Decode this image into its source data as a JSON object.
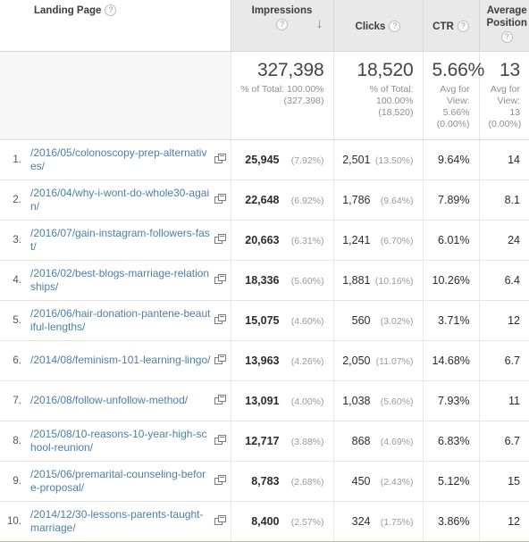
{
  "table": {
    "columns": [
      {
        "key": "index",
        "label": "",
        "help": false,
        "sorted": null
      },
      {
        "key": "page",
        "label": "Landing Page",
        "help": true,
        "sorted": null
      },
      {
        "key": "impressions",
        "label": "Impressions",
        "help": true,
        "sorted": "desc",
        "sort_glyph": "↓"
      },
      {
        "key": "clicks",
        "label": "Clicks",
        "help": true,
        "sorted": null
      },
      {
        "key": "ctr",
        "label": "CTR",
        "help": true,
        "sorted": null
      },
      {
        "key": "position",
        "label": "Average Position",
        "help": true,
        "sorted": null
      }
    ],
    "help_glyph": "?",
    "external_link_icon": "open-in-new-window-icon",
    "summary": {
      "impressions": {
        "value": "327,398",
        "sub": "% of Total: 100.00% (327,398)"
      },
      "clicks": {
        "value": "18,520",
        "sub": "% of Total: 100.00% (18,520)"
      },
      "ctr": {
        "value": "5.66%",
        "sub": "Avg for View: 5.66% (0.00%)"
      },
      "position": {
        "value": "13",
        "sub": "Avg for View: 13 (0.00%)"
      }
    },
    "rows": [
      {
        "index": "1.",
        "page": "/2016/05/colonoscopy-prep-alternatives/",
        "impressions": "25,945",
        "impressions_pct": "(7.92%)",
        "clicks": "2,501",
        "clicks_pct": "(13.50%)",
        "ctr": "9.64%",
        "position": "14"
      },
      {
        "index": "2.",
        "page": "/2016/04/why-i-wont-do-whole30-again/",
        "impressions": "22,648",
        "impressions_pct": "(6.92%)",
        "clicks": "1,786",
        "clicks_pct": "(9.64%)",
        "ctr": "7.89%",
        "position": "8.1"
      },
      {
        "index": "3.",
        "page": "/2016/07/gain-instagram-followers-fast/",
        "impressions": "20,663",
        "impressions_pct": "(6.31%)",
        "clicks": "1,241",
        "clicks_pct": "(6.70%)",
        "ctr": "6.01%",
        "position": "24"
      },
      {
        "index": "4.",
        "page": "/2016/02/best-blogs-marriage-relationships/",
        "impressions": "18,336",
        "impressions_pct": "(5.60%)",
        "clicks": "1,881",
        "clicks_pct": "(10.16%)",
        "ctr": "10.26%",
        "position": "6.4"
      },
      {
        "index": "5.",
        "page": "/2016/06/hair-donation-pantene-beautiful-lengths/",
        "impressions": "15,075",
        "impressions_pct": "(4.60%)",
        "clicks": "560",
        "clicks_pct": "(3.02%)",
        "ctr": "3.71%",
        "position": "12"
      },
      {
        "index": "6.",
        "page": "/2014/08/feminism-101-learning-lingo/",
        "impressions": "13,963",
        "impressions_pct": "(4.26%)",
        "clicks": "2,050",
        "clicks_pct": "(11.07%)",
        "ctr": "14.68%",
        "position": "6.7"
      },
      {
        "index": "7.",
        "page": "/2016/08/follow-unfollow-method/",
        "impressions": "13,091",
        "impressions_pct": "(4.00%)",
        "clicks": "1,038",
        "clicks_pct": "(5.60%)",
        "ctr": "7.93%",
        "position": "11"
      },
      {
        "index": "8.",
        "page": "/2015/08/10-reasons-10-year-high-school-reunion/",
        "impressions": "12,717",
        "impressions_pct": "(3.88%)",
        "clicks": "868",
        "clicks_pct": "(4.69%)",
        "ctr": "6.83%",
        "position": "6.7"
      },
      {
        "index": "9.",
        "page": "/2015/06/premarital-counseling-before-proposal/",
        "impressions": "8,783",
        "impressions_pct": "(2.68%)",
        "clicks": "450",
        "clicks_pct": "(2.43%)",
        "ctr": "5.12%",
        "position": "15"
      },
      {
        "index": "10.",
        "page": "/2014/12/30-lessons-parents-taught-marriage/",
        "impressions": "8,400",
        "impressions_pct": "(2.57%)",
        "clicks": "324",
        "clicks_pct": "(1.75%)",
        "ctr": "3.86%",
        "position": "12"
      }
    ]
  },
  "colors": {
    "link": "#4c7fa8",
    "header_bg": "#e9e9e9",
    "summary_bg": "#f7f7f7",
    "muted_text": "#9b9b9b"
  }
}
